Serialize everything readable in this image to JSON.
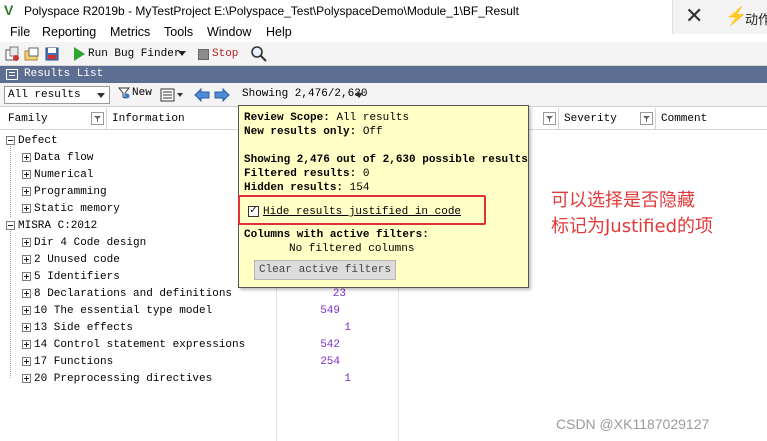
{
  "window": {
    "title": "Polyspace R2019b - MyTestProject E:\\Polyspace_Test\\PolyspaceDemo\\Module_1\\BF_Result",
    "logo": "V"
  },
  "ext_panel": {
    "text": "动作"
  },
  "menu": [
    "File",
    "Reporting",
    "Metrics",
    "Tools",
    "Window",
    "Help"
  ],
  "toolbar": {
    "run_label": "Run Bug Finder",
    "stop_label": "Stop"
  },
  "results_list": {
    "title": "Results List",
    "scope_value": "All results",
    "new_label": "New",
    "showing_label": "Showing 2,476/2,630"
  },
  "columns": {
    "family": "Family",
    "information": "Information",
    "severity": "Severity",
    "comment": "Comment"
  },
  "rows": [
    {
      "label": "Defect",
      "level": 0,
      "count": ""
    },
    {
      "label": "Data flow",
      "level": 1,
      "count": ""
    },
    {
      "label": "Numerical",
      "level": 1,
      "count": ""
    },
    {
      "label": "Programming",
      "level": 1,
      "count": ""
    },
    {
      "label": "Static memory",
      "level": 1,
      "count": ""
    },
    {
      "label": "MISRA C:2012",
      "level": 0,
      "count": ""
    },
    {
      "label": "Dir 4 Code design",
      "level": 1,
      "count": ""
    },
    {
      "label": "2 Unused code",
      "level": 1,
      "count": ""
    },
    {
      "label": "5 Identifiers",
      "level": 1,
      "count": ""
    },
    {
      "label": "8 Declarations and definitions",
      "level": 1,
      "count": "23"
    },
    {
      "label": "10 The essential type model",
      "level": 1,
      "count": "549"
    },
    {
      "label": "13 Side effects",
      "level": 1,
      "count": "1"
    },
    {
      "label": "14 Control statement expressions",
      "level": 1,
      "count": "542"
    },
    {
      "label": "17 Functions",
      "level": 1,
      "count": "254"
    },
    {
      "label": "20 Preprocessing directives",
      "level": 1,
      "count": "1"
    }
  ],
  "popup": {
    "review_scope_key": "Review Scope:",
    "review_scope_val": "All results",
    "new_only_key": "New results only:",
    "new_only_val": "Off",
    "showing_summary": "Showing 2,476 out of 2,630 possible results",
    "filtered_key": "Filtered results:",
    "filtered_val": "0",
    "hidden_key": "Hidden results:",
    "hidden_val": "154",
    "hide_label": "Hide results justified in code",
    "hide_checked": true,
    "columns_heading": "Columns with active filters:",
    "no_filtered": "No filtered columns",
    "clear_button": "Clear active filters"
  },
  "annotation": {
    "line1": "可以选择是否隐藏",
    "line2": "标记为Justified的项",
    "color": "#e03a3a"
  },
  "watermark": "CSDN @XK1187029127"
}
